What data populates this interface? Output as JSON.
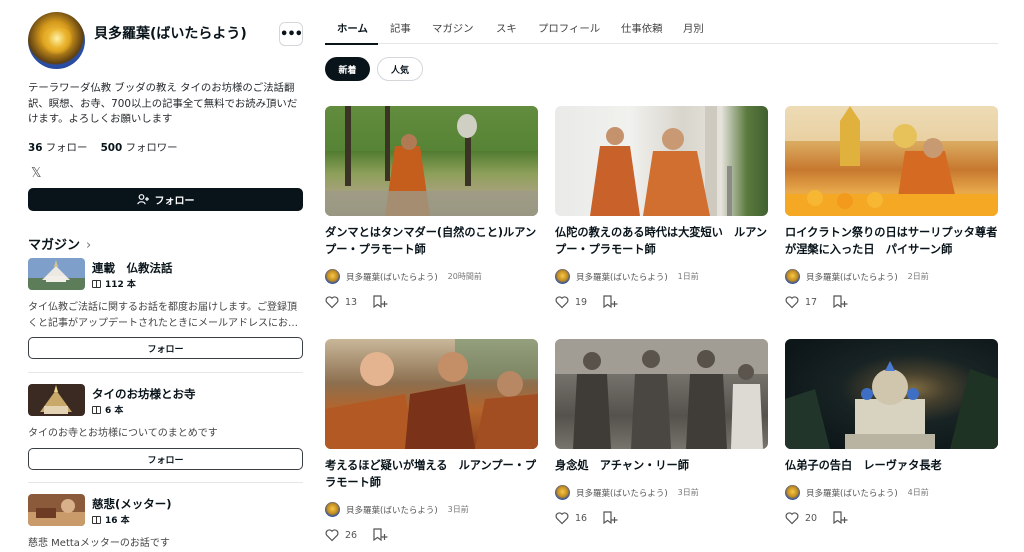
{
  "profile": {
    "name": "貝多羅葉(ばいたらよう)",
    "bio": "テーラワーダ仏教 ブッダの教え タイのお坊様のご法話翻訳、瞑想、お寺、700以上の記事全て無料でお読み頂いだけます。よろしくお願いします",
    "following_count": "36",
    "following_label": "フォロー",
    "followers_count": "500",
    "followers_label": "フォロワー",
    "more_label": "•••",
    "follow_button": "フォロー",
    "social_icon": "x-icon"
  },
  "magazines": {
    "heading": "マガジン",
    "items": [
      {
        "title": "連載　仏教法話",
        "count": "112 本",
        "description": "タイ仏教ご法話に関するお話を都度お届けします。ご登録頂くと記事がアップデートされたときにメールアドレスにお…",
        "follow_label": "フォロー"
      },
      {
        "title": "タイのお坊様とお寺",
        "count": "6 本",
        "description": "タイのお寺とお坊様についてのまとめです",
        "follow_label": "フォロー"
      },
      {
        "title": "慈悲(メッター)",
        "count": "16 本",
        "description": "慈悲 Mettaメッターのお話です"
      }
    ]
  },
  "nav": {
    "tabs": [
      "ホーム",
      "記事",
      "マガジン",
      "スキ",
      "プロフィール",
      "仕事依頼",
      "月別"
    ],
    "active_tab": "ホーム"
  },
  "filters": {
    "new": "新着",
    "popular": "人気"
  },
  "articles": [
    {
      "title": "ダンマとはタンマダー(自然のこと)ルアンプー・プラモート師",
      "author": "貝多羅葉(ばいたらよう)",
      "time": "20時間前",
      "likes": "13"
    },
    {
      "title": "仏陀の教えのある時代は大変短い　ルアンプー・プラモート師",
      "author": "貝多羅葉(ばいたらよう)",
      "time": "1日前",
      "likes": "19"
    },
    {
      "title": "ロイクラトン祭りの日はサーリプッタ尊者が涅槃に入った日　パイサーン師",
      "author": "貝多羅葉(ばいたらよう)",
      "time": "2日前",
      "likes": "17"
    },
    {
      "title": "考えるほど疑いが増える　ルアンプー・プラモート師",
      "author": "貝多羅葉(ばいたらよう)",
      "time": "3日前",
      "likes": "26"
    },
    {
      "title": "身念処　アチャン・リー師",
      "author": "貝多羅葉(ばいたらよう)",
      "time": "3日前",
      "likes": "16"
    },
    {
      "title": "仏弟子の告白　レーヴァタ長老",
      "author": "貝多羅葉(ばいたらよう)",
      "time": "4日前",
      "likes": "20"
    }
  ],
  "colors": {
    "primary": "#08131a",
    "border": "#d4d7da",
    "muted": "#777777"
  }
}
